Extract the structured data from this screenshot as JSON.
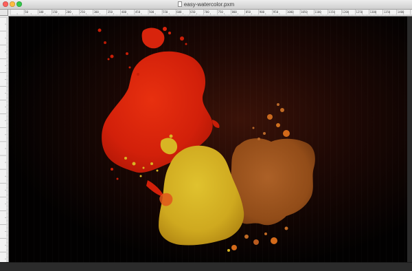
{
  "window": {
    "title": "easy-watercolor.pxm"
  },
  "ruler": {
    "top_labels": [
      "50",
      "100",
      "150",
      "200",
      "250",
      "300",
      "350",
      "400",
      "450",
      "500",
      "550",
      "600",
      "650",
      "700",
      "750",
      "800",
      "850",
      "900",
      "950",
      "1000",
      "1050",
      "1100",
      "1150",
      "1200",
      "1250",
      "1300",
      "1350",
      "1400"
    ]
  },
  "colors": {
    "canvas_bg": "#000000",
    "red_paint": "#d6200a",
    "yellow_paint": "#d8b524",
    "brown_paint": "#a9581c",
    "orange_splash": "#e0561a"
  }
}
